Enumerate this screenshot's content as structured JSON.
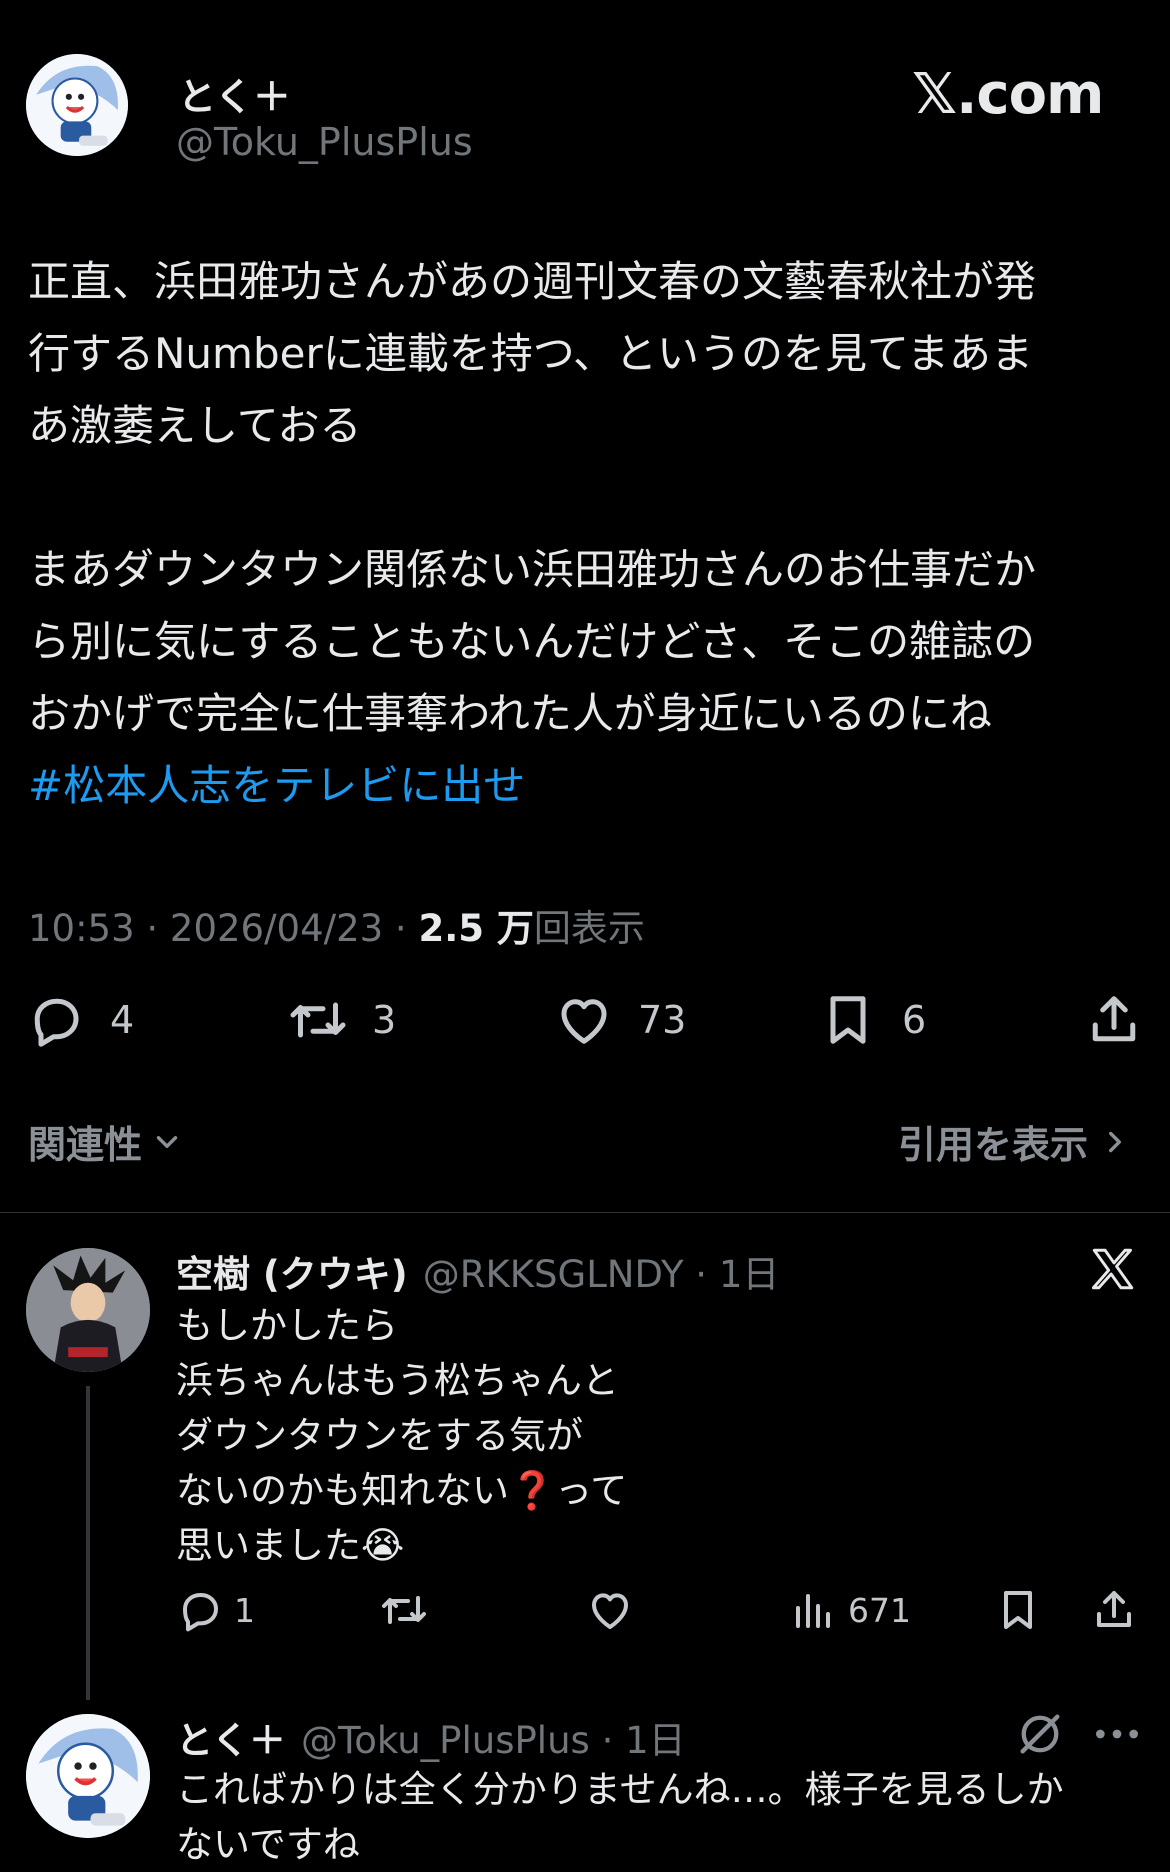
{
  "tweet": {
    "author_name": "とく＋",
    "author_handle": "@Toku_PlusPlus",
    "site_label": "𝕏.com",
    "body": "正直、浜田雅功さんがあの週刊文春の文藝春秋社が発\n行するNumberに連載を持つ、というのを見てまあま\nあ激萎えしておる\n\nまあダウンタウン関係ない浜田雅功さんのお仕事だか\nら別に気にすることもないんだけどさ、そこの雑誌の\nおかげで完全に仕事奪われた人が身近にいるのにね",
    "hashtag": "#松本人志をテレビに出せ",
    "time": "10:53 · 2026/04/23 · ",
    "views_count": "2.5 万",
    "views_label": "回表示",
    "actions": {
      "replies": "4",
      "retweets": "3",
      "likes": "73",
      "bookmarks": "6"
    }
  },
  "sort_bar": {
    "sort_label": "関連性",
    "quotes_label": "引用を表示"
  },
  "replies": [
    {
      "name": "空樹 (クウキ)",
      "handle": "@RKKSGLNDY · 1日",
      "text": "もしかしたら\n浜ちゃんはもう松ちゃんと\nダウンタウンをする気が\nないのかも知れない❓って\n思いました😭",
      "reply_count": "1",
      "views": "671"
    },
    {
      "name": "とく＋",
      "handle": "@Toku_PlusPlus · 1日",
      "text": "こればかりは全く分かりませんね…。様子を見るしか\nないですね"
    }
  ],
  "icons": [
    "reply-icon",
    "retweet-icon",
    "like-icon",
    "bookmark-icon",
    "share-icon",
    "chevron-down-icon",
    "chevron-right-icon",
    "x-logo-icon",
    "views-icon",
    "more-icon",
    "grok-icon"
  ],
  "colors": {
    "background": "#000000",
    "text": "#e7e9ea",
    "muted": "#71767b",
    "link": "#1d9bf0",
    "divider": "#2f3336"
  }
}
